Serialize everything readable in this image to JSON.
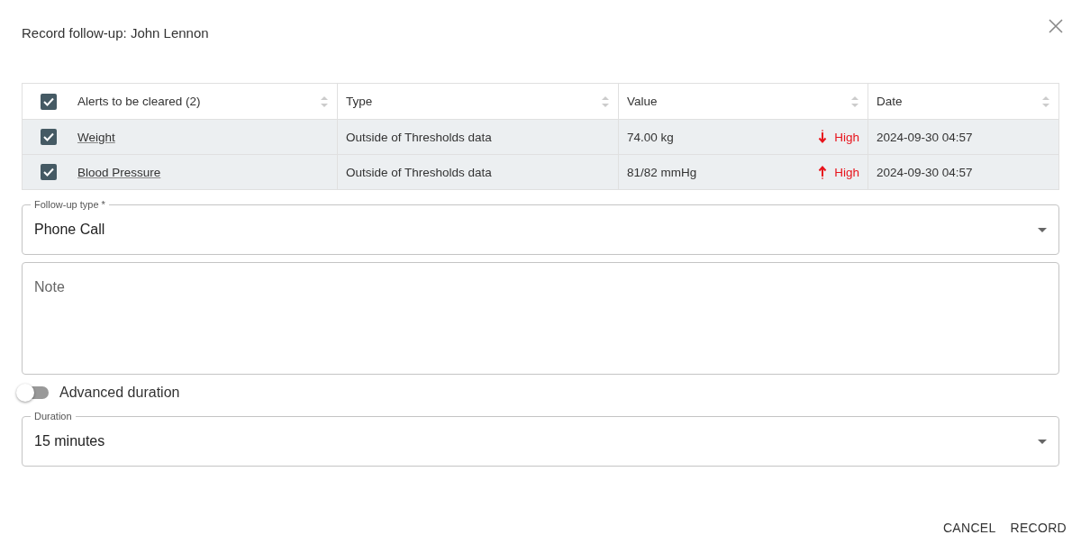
{
  "dialog": {
    "title": "Record follow-up: John Lennon"
  },
  "table": {
    "select_all": {
      "checked": true
    },
    "columns": [
      "Alerts to be cleared (2)",
      "Type",
      "Value",
      "Date"
    ],
    "rows": [
      {
        "checked": true,
        "alert": "Weight",
        "type": "Outside of Thresholds data",
        "value": "74.00 kg",
        "kind": "falling",
        "flag": "High",
        "date": "2024-09-30 04:57"
      },
      {
        "checked": true,
        "alert": "Blood Pressure",
        "type": "Outside of Thresholds data",
        "value": "81/82 mmHg",
        "kind": "rising",
        "flag": "High",
        "date": "2024-09-30 04:57"
      }
    ]
  },
  "follow_up_type": {
    "label": "Follow-up type *",
    "value": "Phone Call"
  },
  "note": {
    "placeholder": "Note"
  },
  "advanced_duration": {
    "label": "Advanced duration",
    "on": false
  },
  "duration": {
    "label": "Duration",
    "value": "15 minutes"
  },
  "buttons": [
    "CANCEL",
    "RECORD"
  ]
}
